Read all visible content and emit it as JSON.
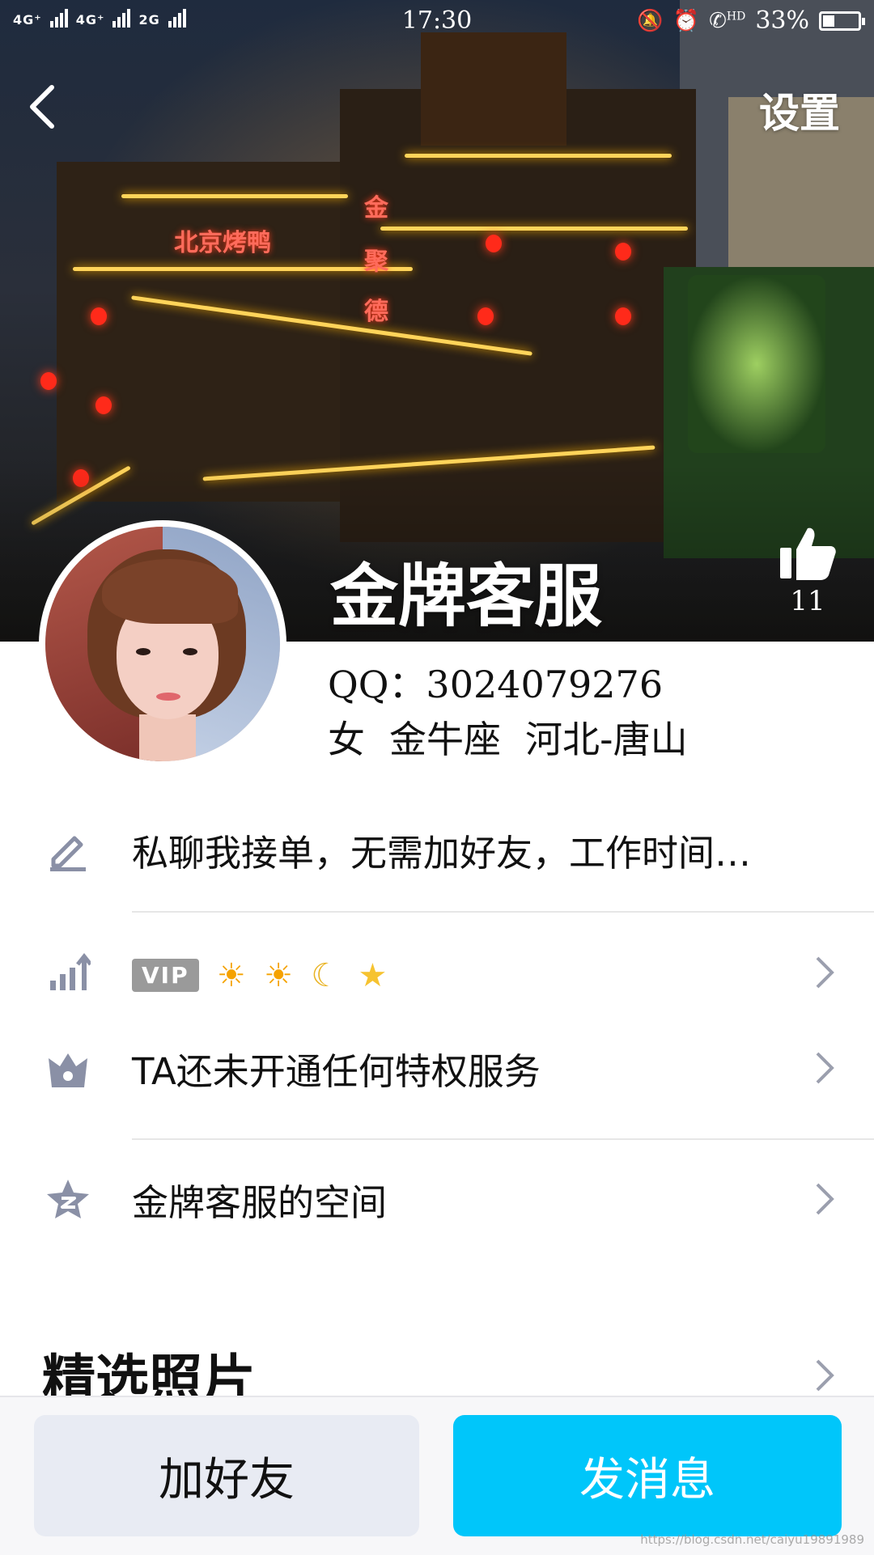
{
  "status_bar": {
    "network_left": "4G⁺",
    "network_mid": "4G⁺",
    "network_right": "2G",
    "time": "17:30",
    "hd_label": "HD",
    "battery_percent": "33%",
    "battery_level": 0.33,
    "icons": [
      "mute-bell-icon",
      "alarm-icon",
      "hd-call-icon",
      "battery-icon"
    ]
  },
  "nav": {
    "back_icon": "chevron-left-icon",
    "settings_label": "设置"
  },
  "profile": {
    "nickname": "金牌客服",
    "likes_count": "11",
    "qq_line": "QQ：3024079276",
    "gender": "女",
    "zodiac": "金牛座",
    "location": "河北-唐山",
    "cover_signs": [
      "北京烤鸭",
      "金",
      "聚",
      "德"
    ]
  },
  "list": {
    "signature": "私聊我接单，无需加好友，工作时间…",
    "vip_badge": "VIP",
    "level_icons": [
      "☀",
      "☀",
      "☾",
      "★"
    ],
    "privilege_text": "TA还未开通任何特权服务",
    "space_text": "金牌客服的空间"
  },
  "section": {
    "featured_photos": "精选照片"
  },
  "actions": {
    "add_friend": "加好友",
    "send_message": "发消息"
  },
  "watermark": "https://blog.csdn.net/caiyu19891989",
  "colors": {
    "primary_button": "#00c6fa",
    "secondary_button": "#e8ebf3",
    "icon_gray": "#8a90a6"
  }
}
